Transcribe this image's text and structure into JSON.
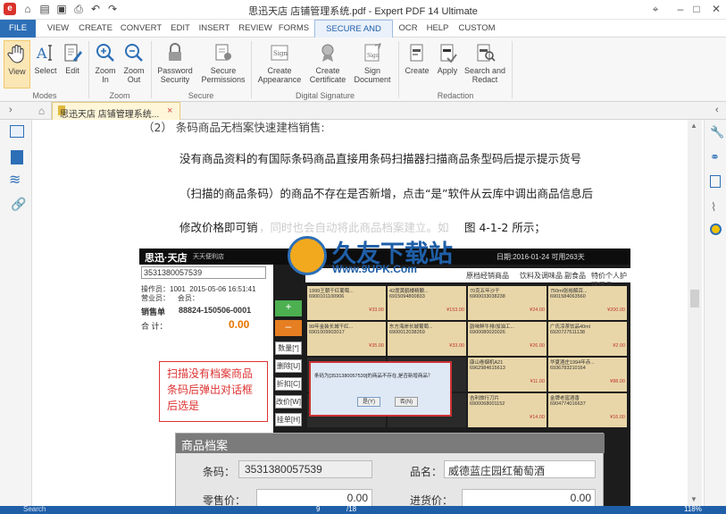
{
  "window": {
    "title": "思迅天店 店铺管理系统.pdf  -  Expert PDF 14 Ultimate"
  },
  "menu": [
    "FILE",
    "VIEW",
    "CREATE",
    "CONVERT",
    "EDIT",
    "INSERT",
    "REVIEW",
    "FORMS",
    "SECURE AND SIGN",
    "OCR",
    "HELP",
    "CUSTOM"
  ],
  "ribbon": {
    "modes": {
      "group": "Modes",
      "view": "View",
      "select": "Select",
      "edit": "Edit"
    },
    "zoom": {
      "group": "Zoom",
      "zoom_in": "Zoom In",
      "zoom_out": "Zoom Out"
    },
    "secure": {
      "group": "Secure",
      "password": "Password Security",
      "permissions": "Secure Permissions"
    },
    "signature": {
      "group": "Digital Signature",
      "create_appearance": "Create Appearance",
      "create_certificate": "Create Certificate",
      "sign_document": "Sign Document"
    },
    "redaction": {
      "group": "Redaction",
      "create": "Create",
      "apply": "Apply",
      "search_redact": "Search and Redact"
    }
  },
  "tab": {
    "label": "思迅天店 店铺管理系统...",
    "close": "×"
  },
  "document": {
    "line0": "（2）  条码商品无档案快速建档销售:",
    "line1": "没有商品资料的有国际条码商品直接用条码扫描器扫描商品条型码后提示提示货号",
    "line2": "（扫描的商品条码）的商品不存在是否新增，点击“是”软件从云库中调出商品信息后",
    "line3a": "修改价格即可销",
    "line3b": "，同时也会自动将此商品档案建立。如",
    "line3c": "图 4-1-2 所示；",
    "watermark": "久友下载站",
    "watermark_url": "Www.9UPK.Com",
    "shot": {
      "app": "思迅·天店",
      "app_sub": "天天便利店",
      "datetime": "日期:2016-01-24  可用263天",
      "barcode": "3531380057539",
      "operator_label": "操作员：",
      "operator": "1001",
      "date_label": "2015-05-06 16:51:41",
      "store_label": "营业员：",
      "member_label": "会员：",
      "order_label": "销售单",
      "order_no": "88824-150506-0001",
      "total_label": "合 计：",
      "total": "0.00",
      "tabs": [
        "原档经销商品",
        "饮料及调味品",
        "副食品",
        "特价个人护理用品"
      ],
      "tiles": [
        {
          "name": "1999王朝干红葡萄...",
          "code": "6900101100906",
          "price": "¥33.00"
        },
        {
          "name": "42度黄鹤楼精酿...",
          "code": "6915094800833",
          "price": "¥153.00"
        },
        {
          "name": "70克五年沙干",
          "code": "6900033038238",
          "price": "¥24.00"
        },
        {
          "name": "750ml张裕解百...",
          "code": "6901584063560",
          "price": "¥200.00"
        },
        {
          "name": "99年金装长城干红...",
          "code": "6901009903017",
          "price": "¥35.00"
        },
        {
          "name": "东方海岸长城葡萄...",
          "code": "6900012038269",
          "price": "¥33.00"
        },
        {
          "name": "韵味鲜牛排/加油工...",
          "code": "6900080020026",
          "price": "¥26.00"
        },
        {
          "name": "广氏凉茶饮品40ml",
          "code": "6920727511138",
          "price": "¥2.00"
        },
        {
          "name": "",
          "code": "",
          "price": ""
        },
        {
          "name": "",
          "code": "",
          "price": ""
        },
        {
          "name": "康山卷烟机A21",
          "code": "6962984615613",
          "price": "¥11.00"
        },
        {
          "name": "华夏酒庄1994年赤...",
          "code": "6936783210164",
          "price": "¥88.00"
        },
        {
          "name": "",
          "code": "",
          "price": ""
        },
        {
          "name": "",
          "code": "",
          "price": ""
        },
        {
          "name": "吉利旅行刀片",
          "code": "6900068001152",
          "price": "¥14.00"
        },
        {
          "name": "金牌老窖酒香",
          "code": "6904774016637",
          "price": "¥16.00"
        }
      ],
      "side_buttons": [
        "数量[*]",
        "删除[U]",
        "折扣[C]",
        "改价[W]",
        "挂单[H]"
      ],
      "callout": "扫描没有档案商品条码后弹出对话框后选是",
      "dialog_text": "条码为[3531380057539]的商品不存在,是否新增商品？",
      "dialog_yes": "是(Y)",
      "dialog_no": "否(N)",
      "form_title": "商品档案",
      "form_barcode_label": "条码：",
      "form_barcode": "3531380057539",
      "form_name_label": "品名：",
      "form_name": "威德蓝庄园红葡萄酒",
      "form_price_label": "零售价：",
      "form_price": "0.00",
      "form_cost_label": "进货价：",
      "form_cost": "0.00"
    }
  },
  "status": {
    "search_placeholder": "Search",
    "page": "9",
    "page_total": "/18",
    "zoom": "118%"
  }
}
